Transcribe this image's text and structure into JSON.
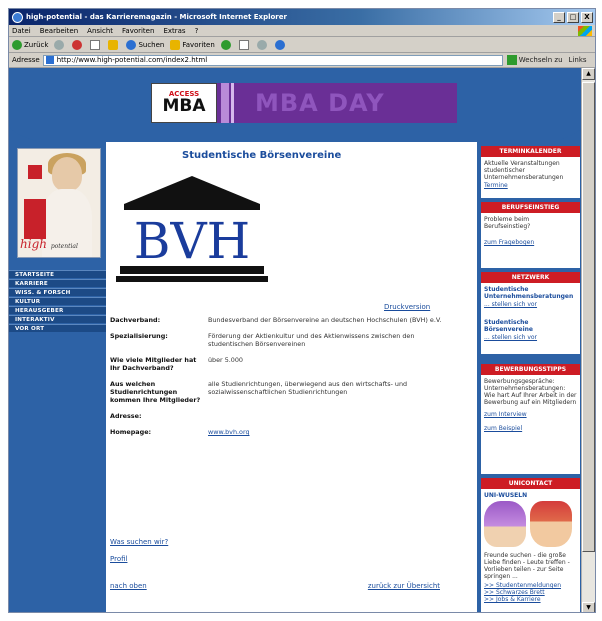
{
  "browser": {
    "title": "high-potential - das Karrieremagazin - Microsoft Internet Explorer",
    "window_buttons": [
      "_",
      "□",
      "X"
    ],
    "menu": [
      "Datei",
      "Bearbeiten",
      "Ansicht",
      "Favoriten",
      "Extras",
      "?"
    ],
    "toolbar": {
      "back": "Zurück",
      "search": "Suchen",
      "favorites": "Favoriten"
    },
    "address_label": "Adresse",
    "address_url": "http://www.high-potential.com/index2.html",
    "go_label": "Wechseln zu",
    "links_label": "Links"
  },
  "banner": {
    "ad_access": "ACCESS",
    "ad_mba": "MBA",
    "ad_day": "MBA DAY"
  },
  "magazine": {
    "title": "high",
    "subtitle": "potential"
  },
  "left_nav": [
    "STARTSEITE",
    "KARRIERE",
    "WISS. & FORSCH",
    "KULTUR",
    "HERAUSGEBER",
    "INTERAKTIV",
    "VOR ORT"
  ],
  "main": {
    "page_title": "Studentische Börsenvereine",
    "logo_text": "BVH",
    "print_link": "Druckversion",
    "rows": [
      {
        "key": "Dachverband:",
        "value": "Bundesverband der Börsenvereine an deutschen Hochschulen (BVH) e.V."
      },
      {
        "key": "Spezialisierung:",
        "value": "Förderung der Aktienkultur und des Aktienwissens zwischen den studentischen Börsenvereinen"
      },
      {
        "key": "Wie viele Mitglieder hat Ihr Dachverband?",
        "value": "über 5.000"
      },
      {
        "key": "Aus welchen Studienrichtungen kommen Ihre Mitglieder?",
        "value": "alle Studienrichtungen, überwiegend aus den wirtschafts- und sozialwissenschaftlichen Studienrichtungen"
      },
      {
        "key": "Adresse:",
        "value": ""
      },
      {
        "key": "Homepage:",
        "value": "www.bvh.org",
        "is_link": true
      }
    ],
    "sublinks": [
      "Was suchen wir?",
      "Profil"
    ],
    "back_up": "nach oben",
    "back_overview": "zurück zur Übersicht"
  },
  "right": {
    "termine": {
      "header": "TERMINKALENDER",
      "text": "Aktuelle Veranstaltungen studentischer Unternehmensberatungen",
      "link": "Termine"
    },
    "berufseinstieg": {
      "header": "BERUFSEINSTIEG",
      "text": "Probleme beim Berufseinstieg?",
      "link": "zum Fragebogen"
    },
    "netzwerk": {
      "header": "NETZWERK",
      "items": [
        {
          "name": "Studentische Unternehmensberatungen",
          "link": "... stellen sich vor"
        },
        {
          "name": "Studentische Börsenvereine",
          "link": "... stellen sich vor"
        }
      ]
    },
    "bewerbung": {
      "header": "BEWERBUNGSSTIPPS",
      "text": "Bewerbungsgespräche: Unternehmensberatungen: Wie hart Auf Ihrer Arbeit in der Bewerbung auf ein Mitgliedern",
      "link1": "zum Interview",
      "link2": "zum Beispiel"
    },
    "unicontact": {
      "header": "UNICONTACT",
      "subheader": "UNI-WUSELN",
      "text": "Freunde suchen - die große Liebe finden - Leute treffen - Vorlieben teilen - zur Seite springen ...",
      "links": [
        ">> Studentenmeldungen",
        ">> Schwarzes Brett",
        ">> Jobs & Karriere"
      ]
    }
  }
}
